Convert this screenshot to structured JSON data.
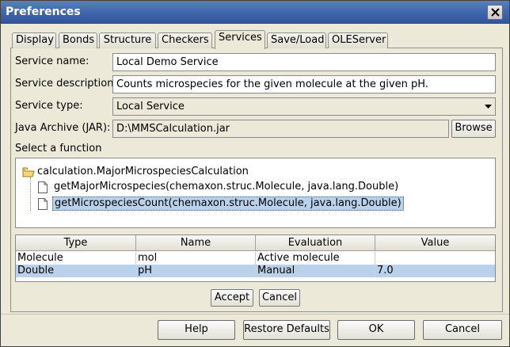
{
  "window": {
    "title": "Preferences"
  },
  "tabs": [
    {
      "label": "Display"
    },
    {
      "label": "Bonds"
    },
    {
      "label": "Structure"
    },
    {
      "label": "Checkers"
    },
    {
      "label": "Services"
    },
    {
      "label": "Save/Load"
    },
    {
      "label": "OLEServer"
    }
  ],
  "active_tab": "Services",
  "form": {
    "service_name_label": "Service name:",
    "service_name_value": "Local Demo Service",
    "service_description_label": "Service description:",
    "service_description_value": "Counts microspecies for the given molecule at the given pH.",
    "service_type_label": "Service type:",
    "service_type_value": "Local Service",
    "jar_label": "Java Archive (JAR):",
    "jar_value": "D:\\MMSCalculation.jar",
    "browse_label": "Browse",
    "select_function_label": "Select a function"
  },
  "tree": {
    "root": "calculation.MajorMicrospeciesCalculation",
    "leaves": [
      {
        "label": "getMajorMicrospecies(chemaxon.struc.Molecule, java.lang.Double)"
      },
      {
        "label": "getMicrospeciesCount(chemaxon.struc.Molecule, java.lang.Double)",
        "selected": true
      }
    ]
  },
  "table": {
    "headers": [
      "Type",
      "Name",
      "Evaluation",
      "Value"
    ],
    "rows": [
      [
        "Molecule",
        "mol",
        "Active molecule",
        ""
      ],
      [
        "Double",
        "pH",
        "Manual",
        "7.0"
      ]
    ],
    "selected_row": 1
  },
  "table_buttons": {
    "accept": "Accept",
    "cancel": "Cancel"
  },
  "footer_buttons": {
    "help": "Help",
    "restore_defaults": "Restore Defaults",
    "ok": "OK",
    "cancel": "Cancel"
  },
  "colors": {
    "title_bar": "#3d63a9",
    "selection": "#b9d1ea"
  }
}
